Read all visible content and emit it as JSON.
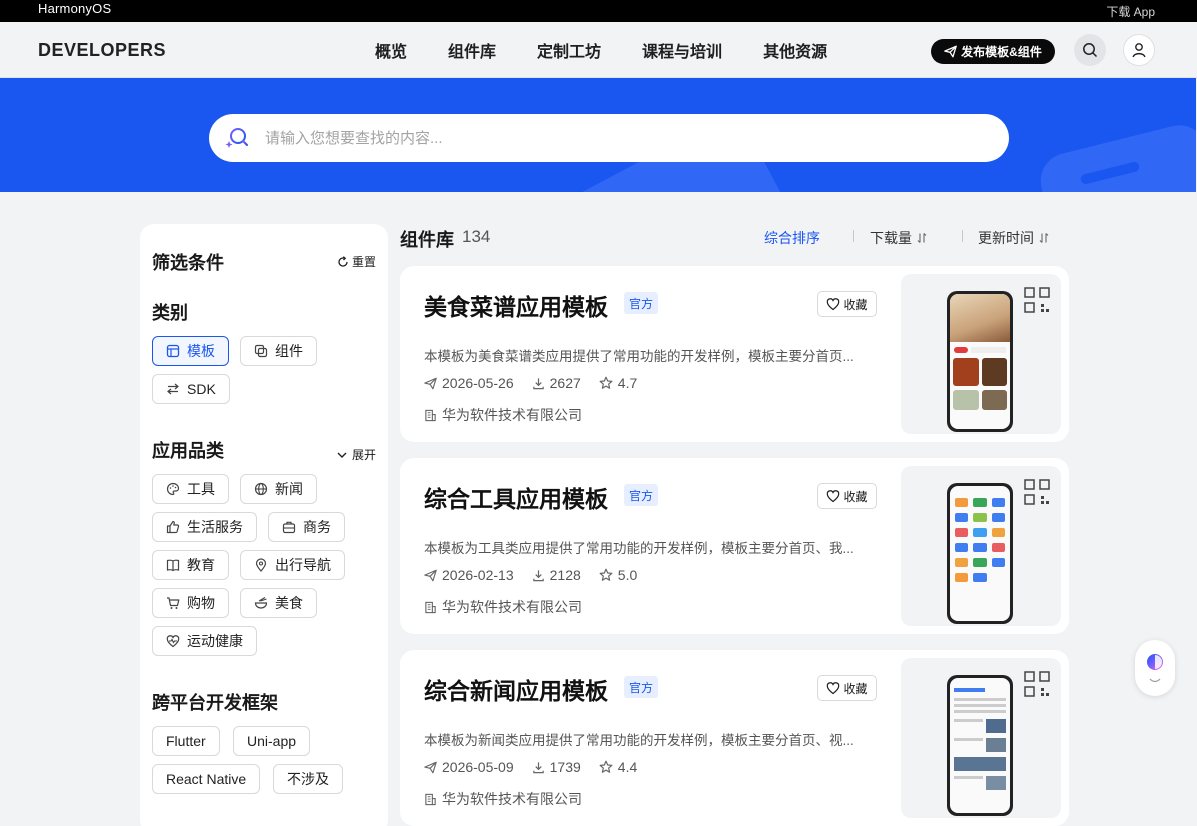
{
  "topbar": {
    "brand": "HarmonyOS",
    "download": "下载 App"
  },
  "nav": {
    "logo": "DEVELOPERS",
    "menu": [
      "概览",
      "组件库",
      "定制工坊",
      "课程与培训",
      "其他资源"
    ],
    "publish": "发布模板&组件"
  },
  "search": {
    "placeholder": "请输入您想要查找的内容..."
  },
  "filter": {
    "title": "筛选条件",
    "reset": "重置",
    "category": {
      "title": "类别",
      "items": [
        "模板",
        "组件",
        "SDK"
      ],
      "active": "模板"
    },
    "app_category": {
      "title": "应用品类",
      "expand": "展开",
      "items": [
        "工具",
        "新闻",
        "生活服务",
        "商务",
        "教育",
        "出行导航",
        "购物",
        "美食",
        "运动健康"
      ]
    },
    "framework": {
      "title": "跨平台开发框架",
      "items": [
        "Flutter",
        "Uni-app",
        "React Native",
        "不涉及"
      ]
    }
  },
  "list": {
    "title": "组件库",
    "count": "134",
    "sort": [
      "综合排序",
      "下载量",
      "更新时间"
    ],
    "sort_active": "综合排序",
    "cards": [
      {
        "title": "美食菜谱应用模板",
        "badge": "官方",
        "fav": "收藏",
        "desc": "本模板为美食菜谱类应用提供了常用功能的开发样例，模板主要分首页...",
        "date": "2026-05-26",
        "downloads": "2627",
        "rating": "4.7",
        "company": "华为软件技术有限公司",
        "thumb": "food"
      },
      {
        "title": "综合工具应用模板",
        "badge": "官方",
        "fav": "收藏",
        "desc": "本模板为工具类应用提供了常用功能的开发样例，模板主要分首页、我...",
        "date": "2026-02-13",
        "downloads": "2128",
        "rating": "5.0",
        "company": "华为软件技术有限公司",
        "thumb": "tools"
      },
      {
        "title": "综合新闻应用模板",
        "badge": "官方",
        "fav": "收藏",
        "desc": "本模板为新闻类应用提供了常用功能的开发样例，模板主要分首页、视...",
        "date": "2026-05-09",
        "downloads": "1739",
        "rating": "4.4",
        "company": "华为软件技术有限公司",
        "thumb": "news"
      }
    ]
  },
  "colors": {
    "accent": "#1a56f0",
    "banner": "#1a56f0",
    "badge_bg": "#e6eeff"
  },
  "icons": [
    "search-icon",
    "user-icon",
    "send-icon",
    "refresh-icon",
    "heart-icon",
    "star-icon",
    "download-icon",
    "building-icon",
    "qr-icon",
    "assistant-icon"
  ]
}
